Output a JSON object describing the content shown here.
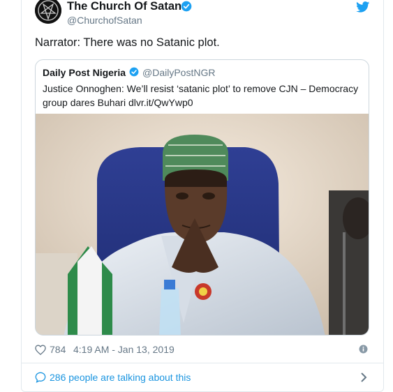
{
  "tweet": {
    "display_name": "The Church Of Satan",
    "handle": "@ChurchofSatan",
    "text": "Narrator: There was no Satanic plot."
  },
  "quoted_tweet": {
    "display_name": "Daily Post Nigeria",
    "handle": "@DailyPostNGR",
    "text": "Justice Onnoghen: We’ll resist ‘satanic plot’ to remove CJN – Democracy group dares Buhari dlvr.it/QwYwp0"
  },
  "meta": {
    "likes": "784",
    "timestamp": "4:19 AM - Jan 13, 2019"
  },
  "footer": {
    "talking_label": "286 people are talking about this"
  },
  "colors": {
    "link_blue": "#1b95e0",
    "verified_blue": "#1da1f2",
    "secondary_text": "#657786",
    "border": "#e1e8ed"
  },
  "icons": [
    "avatar-pentagram-icon",
    "verified-icon",
    "twitter-bird-icon",
    "heart-icon",
    "info-icon",
    "bubble-icon",
    "chevron-right-icon"
  ]
}
